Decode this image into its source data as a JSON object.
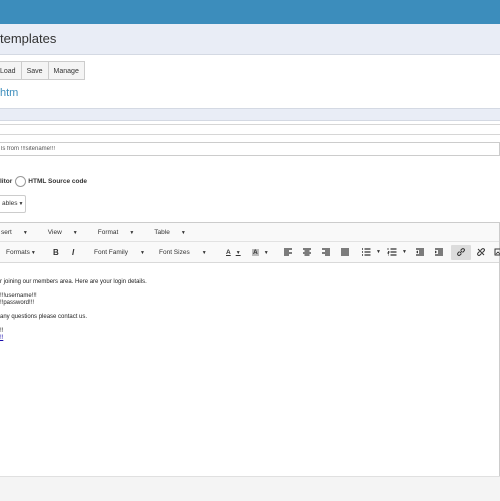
{
  "header": {
    "title": "templates"
  },
  "actions": {
    "load": "Load",
    "save": "Save",
    "manage": "Manage"
  },
  "template": {
    "name": "htm"
  },
  "subject": {
    "value": "ls from !!!sitename!!!"
  },
  "editor_mode": {
    "option1": "litor",
    "option2": "HTML Source code"
  },
  "variables": {
    "label": "ables"
  },
  "menubar": {
    "insert": "sert",
    "view": "View",
    "format": "Format",
    "table": "Table"
  },
  "toolbar": {
    "formats": "Formats",
    "bold": "B",
    "italic": "I",
    "font_family": "Font Family",
    "font_sizes": "Font Sizes",
    "text_color": "A",
    "bg_color": "A"
  },
  "content": {
    "line1": "r joining our members area. Here are your login details.",
    "line2": "!!!username!!!",
    "line3": "!!password!!!",
    "line4": "any questions please contact us.",
    "line5": "!!",
    "line6": "!!"
  }
}
